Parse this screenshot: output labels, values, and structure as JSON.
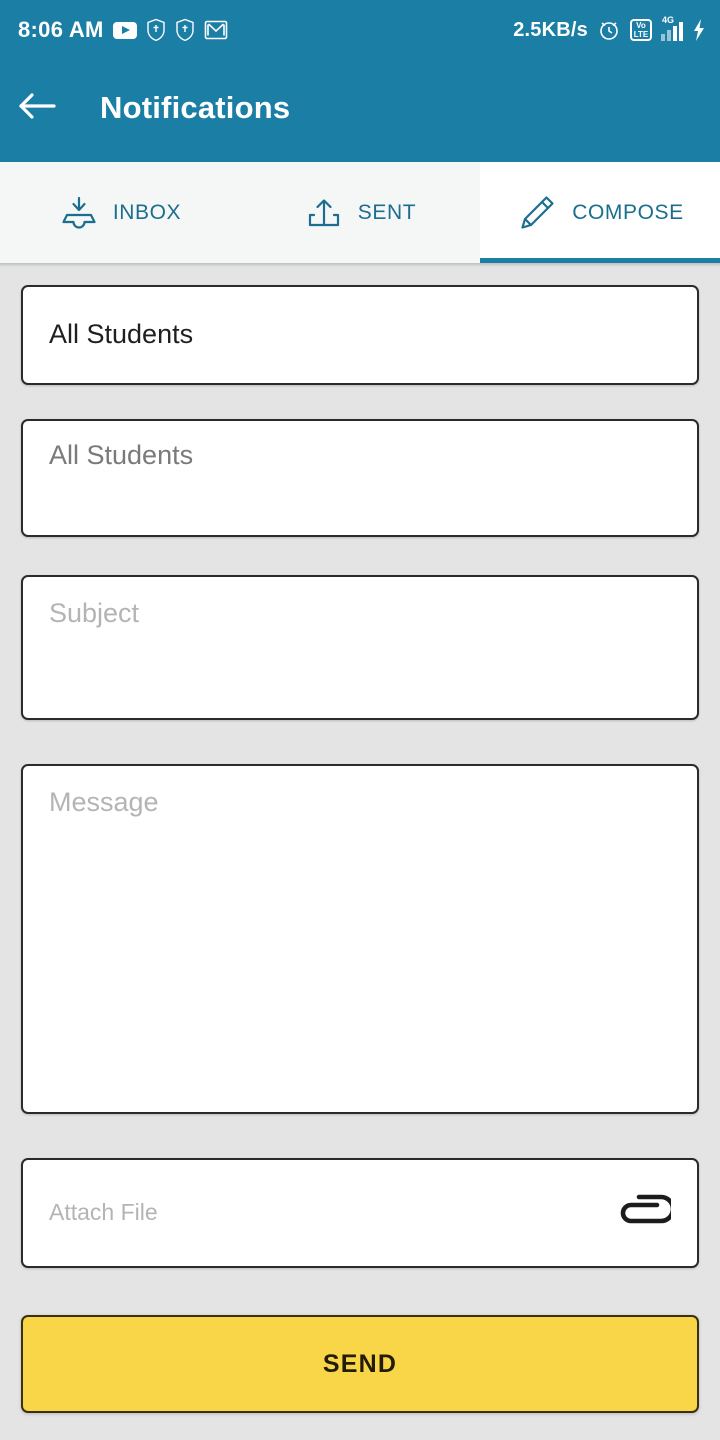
{
  "status_bar": {
    "time": "8:06 AM",
    "network_speed": "2.5KB/s",
    "volte_top": "Vo",
    "volte_bottom": "LTE",
    "network_type": "4G",
    "left_icons": [
      "youtube-icon",
      "shield-icon",
      "shield-icon",
      "gmail-icon"
    ],
    "right_icons": [
      "alarm-clock-icon",
      "volte-icon",
      "signal-bars-icon",
      "charging-bolt-icon"
    ]
  },
  "app_bar": {
    "back_icon": "back-arrow-icon",
    "title": "Notifications"
  },
  "tabs": [
    {
      "label": "INBOX",
      "icon": "inbox-download-icon",
      "active": false
    },
    {
      "label": "SENT",
      "icon": "outbox-upload-icon",
      "active": false
    },
    {
      "label": "COMPOSE",
      "icon": "pencil-icon",
      "active": true
    }
  ],
  "form": {
    "audience": {
      "value": "All Students",
      "placeholder": "All Students"
    },
    "recipients": {
      "value": "",
      "placeholder": "All Students"
    },
    "subject": {
      "value": "",
      "placeholder": "Subject"
    },
    "message": {
      "value": "",
      "placeholder": "Message"
    },
    "attach": {
      "value": "",
      "placeholder": "Attach File",
      "icon": "paperclip-icon"
    },
    "send_label": "SEND"
  },
  "colors": {
    "app_bar": "#1b7ea5",
    "tab_active_text": "#1b6e8d",
    "page_background": "#e4e4e4",
    "send_button": "#f8d648",
    "progress": "#4caf2a"
  }
}
